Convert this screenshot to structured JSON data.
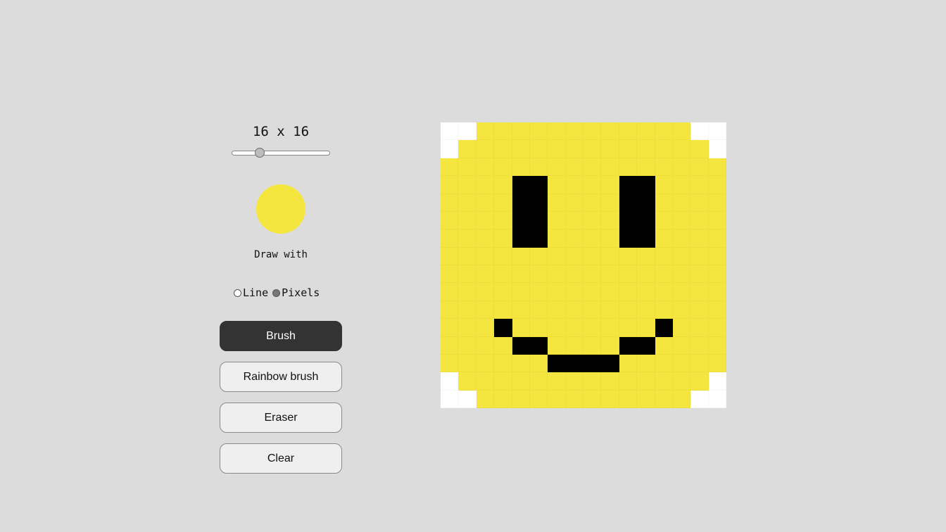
{
  "size_label": "16 x 16",
  "grid_size": 16,
  "slider": {
    "value": 16,
    "min": 1,
    "max": 64,
    "fraction": 0.28
  },
  "current_color": "#f5e63f",
  "draw_with_label": "Draw with",
  "modes": [
    {
      "label": "Line",
      "checked": false
    },
    {
      "label": "Pixels",
      "checked": true
    }
  ],
  "buttons": {
    "brush": {
      "label": "Brush",
      "active": true
    },
    "rainbow": {
      "label": "Rainbow brush",
      "active": false
    },
    "eraser": {
      "label": "Eraser",
      "active": false
    },
    "clear": {
      "label": "Clear",
      "active": false
    }
  },
  "palette": {
    "W": "#ffffff",
    "Y": "#f5e63f",
    "B": "#000000"
  },
  "pixels": [
    "WWYYYYYYYYYYYYWW",
    "WYYYYYYYYYYYYYYW",
    "YYYYYYYYYYYYYYYY",
    "YYYYBBYYYYBBYYYY",
    "YYYYBBYYYYBBYYYY",
    "YYYYBBYYYYBBYYYY",
    "YYYYBBYYYYBBYYYY",
    "YYYYYYYYYYYYYYYY",
    "YYYYYYYYYYYYYYYY",
    "YYYYYYYYYYYYYYYY",
    "YYYYYYYYYYYYYYYY",
    "YYYBYYYYYYYYBYYY",
    "YYYYBBYYYYBBYYYY",
    "YYYYYYBBBBYYYYYY",
    "WYYYYYYYYYYYYYYW",
    "WWYYYYYYYYYYYYWW"
  ]
}
